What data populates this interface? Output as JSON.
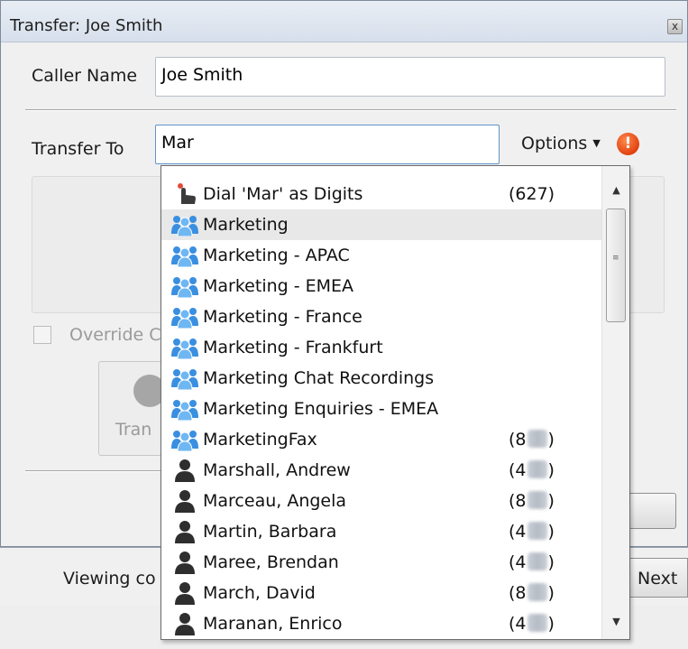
{
  "window": {
    "title": "Transfer: Joe Smith",
    "close_label": "x"
  },
  "caller": {
    "label": "Caller Name",
    "value": "Joe Smith"
  },
  "transfer": {
    "label": "Transfer To",
    "value": "Mar",
    "options_label": "Options",
    "warning_label": "!"
  },
  "override": {
    "label": "Override C"
  },
  "transfer_button": {
    "label": "Tran"
  },
  "footer": {
    "viewing_text": "Viewing co",
    "next_label": "Next"
  },
  "dropdown": {
    "items": [
      {
        "name": "Dial 'Mar' as Digits",
        "ext": "(627)",
        "icon": "dial-hand-icon",
        "ext_masked": false
      },
      {
        "name": "Marketing",
        "ext": "",
        "icon": "group-icon",
        "ext_masked": false
      },
      {
        "name": "Marketing - APAC",
        "ext": "",
        "icon": "group-icon",
        "ext_masked": false
      },
      {
        "name": "Marketing - EMEA",
        "ext": "",
        "icon": "group-icon",
        "ext_masked": false
      },
      {
        "name": "Marketing - France",
        "ext": "",
        "icon": "group-icon",
        "ext_masked": false
      },
      {
        "name": "Marketing - Frankfurt",
        "ext": "",
        "icon": "group-icon",
        "ext_masked": false
      },
      {
        "name": "Marketing Chat Recordings",
        "ext": "",
        "icon": "group-icon",
        "ext_masked": false
      },
      {
        "name": "Marketing Enquiries - EMEA",
        "ext": "",
        "icon": "group-icon",
        "ext_masked": false
      },
      {
        "name": "MarketingFax",
        "ext": "(8",
        "icon": "group-icon",
        "ext_masked": true
      },
      {
        "name": "Marshall, Andrew",
        "ext": "(4",
        "icon": "person-icon",
        "ext_masked": true
      },
      {
        "name": "Marceau, Angela",
        "ext": "(8",
        "icon": "person-icon",
        "ext_masked": true
      },
      {
        "name": "Martin, Barbara",
        "ext": "(4",
        "icon": "person-icon",
        "ext_masked": true
      },
      {
        "name": "Maree, Brendan",
        "ext": "(4",
        "icon": "person-icon",
        "ext_masked": true
      },
      {
        "name": "March, David",
        "ext": "(8",
        "icon": "person-icon",
        "ext_masked": true
      },
      {
        "name": "Maranan, Enrico",
        "ext": "(4",
        "icon": "person-icon",
        "ext_masked": true
      }
    ],
    "selected_index": 1,
    "scroll_up_glyph": "▲",
    "scroll_down_glyph": "▼"
  },
  "colors": {
    "group_icon": "#3a8fe0",
    "person_icon": "#2e2e2e",
    "selected_row": "#e8e8e8"
  }
}
